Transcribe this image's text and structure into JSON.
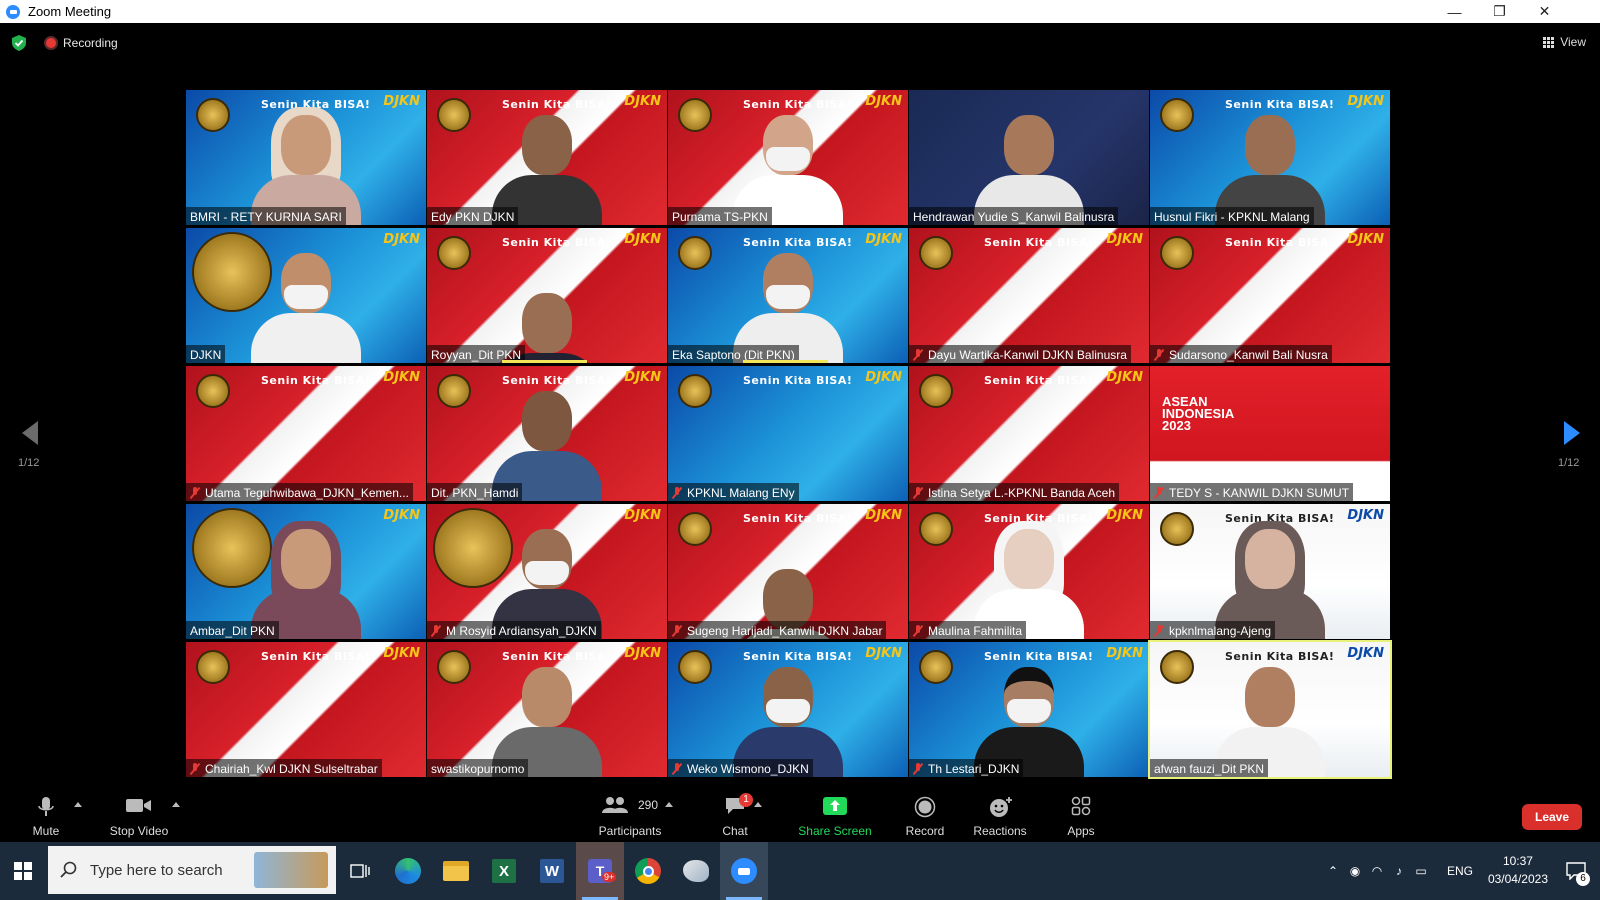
{
  "window": {
    "title": "Zoom Meeting",
    "minimize": "—",
    "maximize": "❐",
    "close": "✕"
  },
  "meeting": {
    "recording_label": "Recording",
    "view_label": "View"
  },
  "paging": {
    "page_left": "1/12",
    "page_right": "1/12"
  },
  "tile_text": {
    "banner": "Senin Kita BISA!",
    "logo": "DJKN",
    "asean": "ASEAN INDONESIA 2023"
  },
  "participants": [
    {
      "name": "BMRI - RETY KURNIA SARI",
      "muted": false
    },
    {
      "name": "Edy PKN DJKN",
      "muted": false
    },
    {
      "name": "Purnama TS-PKN",
      "muted": false
    },
    {
      "name": "Hendrawan Yudie S_Kanwil Balinusra",
      "muted": false
    },
    {
      "name": "Husnul Fikri - KPKNL Malang",
      "muted": false
    },
    {
      "name": "DJKN",
      "muted": false
    },
    {
      "name": "Royyan_Dit PKN",
      "muted": false
    },
    {
      "name": "Eka Saptono (Dit PKN)",
      "muted": false
    },
    {
      "name": "Dayu Wartika-Kanwil DJKN Balinusra",
      "muted": true
    },
    {
      "name": "Sudarsono_Kanwil Bali Nusra",
      "muted": true
    },
    {
      "name": "Utama Teguhwibawa_DJKN_Kemen...",
      "muted": true
    },
    {
      "name": "Dit. PKN_Hamdi",
      "muted": false
    },
    {
      "name": "KPKNL Malang ENy",
      "muted": true
    },
    {
      "name": "Istina Setya L.-KPKNL Banda Aceh",
      "muted": true
    },
    {
      "name": "TEDY S - KANWIL DJKN SUMUT",
      "muted": true
    },
    {
      "name": "Ambar_Dit PKN",
      "muted": false
    },
    {
      "name": "M Rosyid Ardiansyah_DJKN",
      "muted": true
    },
    {
      "name": "Sugeng Harijadi_Kanwil DJKN Jabar",
      "muted": true
    },
    {
      "name": "Maulina Fahmilita",
      "muted": true
    },
    {
      "name": "kpknlmalang-Ajeng",
      "muted": true
    },
    {
      "name": "Chairiah_Kwl DJKN Sulseltrabar",
      "muted": true
    },
    {
      "name": "swastikopurnomo",
      "muted": false
    },
    {
      "name": "Weko Wismono_DJKN",
      "muted": true
    },
    {
      "name": "Th Lestari_DJKN",
      "muted": true
    },
    {
      "name": "afwan fauzi_Dit PKN",
      "muted": false
    }
  ],
  "toolbar": {
    "mute": "Mute",
    "stop_video": "Stop Video",
    "participants": "Participants",
    "participants_count": "290",
    "chat": "Chat",
    "chat_badge": "1",
    "share_screen": "Share Screen",
    "record": "Record",
    "reactions": "Reactions",
    "apps": "Apps",
    "leave": "Leave"
  },
  "taskbar": {
    "search_placeholder": "Type here to search",
    "teams_badge": "9+",
    "lang": "ENG",
    "time": "10:37",
    "date": "03/04/2023",
    "notif_count": "6"
  },
  "colors": {
    "share_green": "#23d959",
    "leave_red": "#d9302c",
    "active_speaker": "#e8f27a",
    "recording_red": "#e53935"
  }
}
